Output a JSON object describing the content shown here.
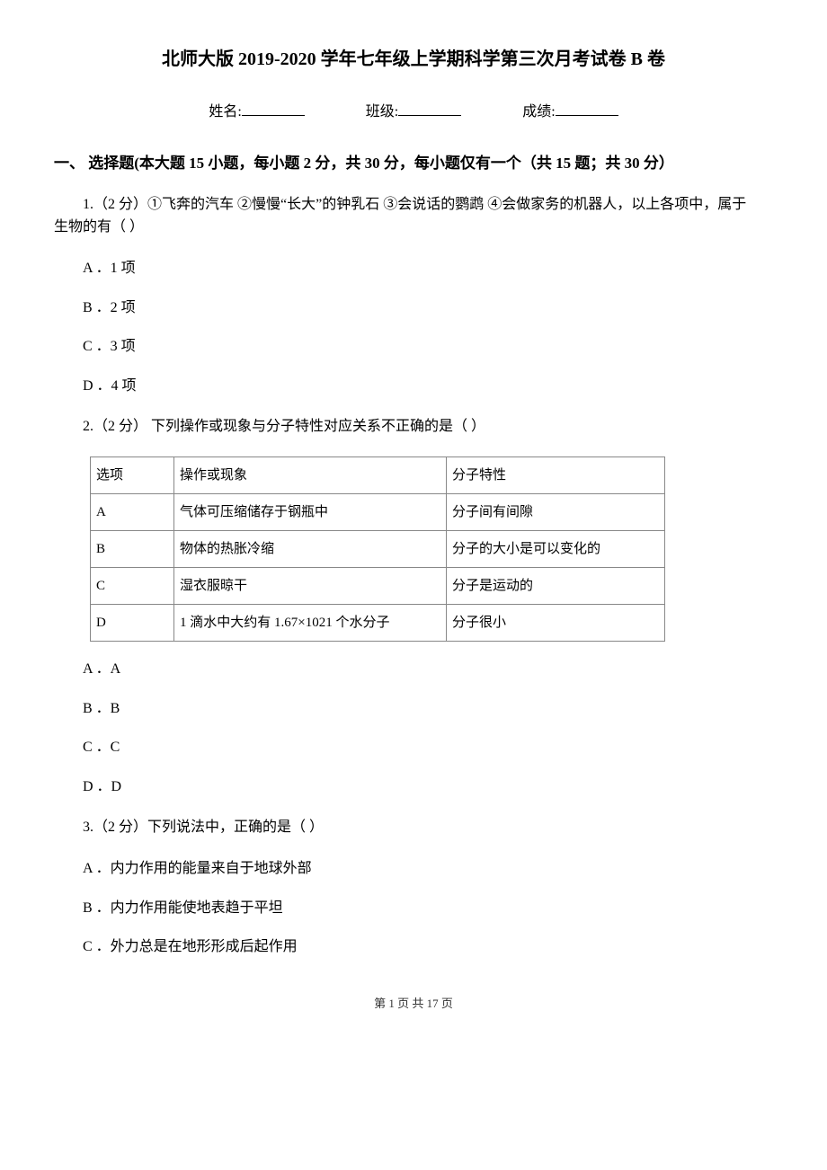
{
  "title": "北师大版 2019-2020 学年七年级上学期科学第三次月考试卷 B 卷",
  "info": {
    "name_label": "姓名:",
    "class_label": "班级:",
    "score_label": "成绩:"
  },
  "section1": {
    "heading": "一、 选择题(本大题 15 小题，每小题 2 分，共 30 分，每小题仅有一个（共 15 题；共 30 分）"
  },
  "q1": {
    "stem": "1.（2 分）①飞奔的汽车 ②慢慢“长大”的钟乳石 ③会说话的鹦鹉 ④会做家务的机器人，以上各项中，属于生物的有（   ）",
    "a": "A ．1 项",
    "b": "B ．2 项",
    "c": "C ．3 项",
    "d": "D ．4 项"
  },
  "q2": {
    "stem": "2.（2 分）  下列操作或现象与分子特性对应关系不正确的是（   ）",
    "table": {
      "h1": "选项",
      "h2": "操作或现象",
      "h3": "分子特性",
      "rA1": "A",
      "rA2": "气体可压缩储存于钢瓶中",
      "rA3": "分子间有间隙",
      "rB1": "B",
      "rB2": "物体的热胀冷缩",
      "rB3": "分子的大小是可以变化的",
      "rC1": "C",
      "rC2": "湿衣服晾干",
      "rC3": "分子是运动的",
      "rD1": "D",
      "rD2": "1 滴水中大约有 1.67×1021 个水分子",
      "rD3": "分子很小"
    },
    "a": "A ．A",
    "b": "B ．B",
    "c": "C ．C",
    "d": "D ．D"
  },
  "q3": {
    "stem": "3.（2 分）下列说法中，正确的是（   ）",
    "a": "A ．内力作用的能量来自于地球外部",
    "b": "B ．内力作用能使地表趋于平坦",
    "c": "C ．外力总是在地形形成后起作用"
  },
  "footer": "第 1 页 共 17 页"
}
